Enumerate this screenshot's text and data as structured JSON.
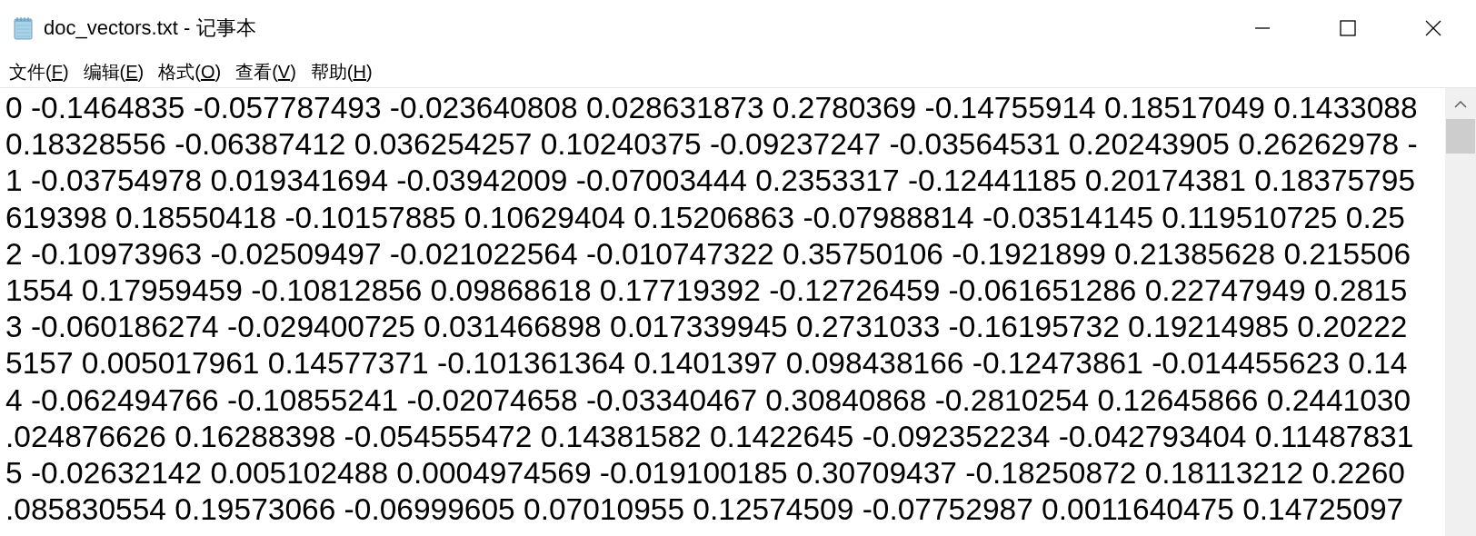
{
  "window": {
    "title": "doc_vectors.txt - 记事本"
  },
  "menu": [
    {
      "label": "文件(F)"
    },
    {
      "label": "编辑(E)"
    },
    {
      "label": "格式(O)"
    },
    {
      "label": "查看(V)"
    },
    {
      "label": "帮助(H)"
    }
  ],
  "lines": [
    "0 -0.1464835 -0.057787493 -0.023640808 0.028631873 0.2780369 -0.14755914 0.18517049 0.1433088",
    "0.18328556 -0.06387412 0.036254257 0.10240375 -0.09237247 -0.03564531 0.20243905 0.26262978 -",
    "1 -0.03754978 0.019341694 -0.03942009 -0.07003444 0.2353317 -0.12441185 0.20174381 0.18375795",
    "619398 0.18550418 -0.10157885 0.10629404 0.15206863 -0.07988814 -0.03514145 0.119510725 0.25",
    "2 -0.10973963 -0.02509497 -0.021022564 -0.010747322 0.35750106 -0.1921899 0.21385628 0.215506",
    "1554 0.17959459 -0.10812856 0.09868618 0.17719392 -0.12726459 -0.061651286 0.22747949 0.2815",
    "3 -0.060186274 -0.029400725 0.031466898 0.017339945 0.2731033 -0.16195732 0.19214985 0.20222",
    "5157 0.005017961 0.14577371 -0.101361364 0.1401397 0.098438166 -0.12473861 -0.014455623 0.14",
    "4 -0.062494766 -0.10855241 -0.02074658 -0.03340467 0.30840868 -0.2810254 0.12645866 0.2441030",
    ".024876626 0.16288398 -0.054555472 0.14381582 0.1422645 -0.092352234 -0.042793404 0.11487831",
    "5 -0.02632142 0.005102488 0.0004974569 -0.019100185 0.30709437 -0.18250872 0.18113212 0.2260",
    ".085830554 0.19573066 -0.06999605 0.07010955 0.12574509 -0.07752987 0.0011640475 0.14725097"
  ]
}
